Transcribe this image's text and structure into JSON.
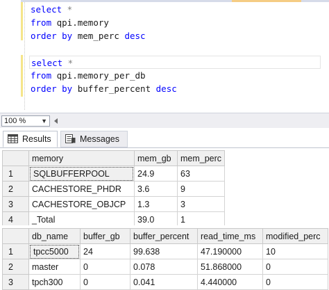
{
  "editor": {
    "lines": [
      {
        "kw1": "select",
        "rest": " *",
        "kind": "select"
      },
      {
        "kw1": "from",
        "rest": " qpi.memory",
        "kind": "from"
      },
      {
        "kw1": "order by",
        "rest": " mem_perc ",
        "kw2": "desc",
        "kind": "order"
      },
      {
        "kw1": "",
        "rest": "",
        "kind": "blank"
      },
      {
        "kw1": "select",
        "rest": " *",
        "kind": "select"
      },
      {
        "kw1": "from",
        "rest": " qpi.memory_per_db",
        "kind": "from"
      },
      {
        "kw1": "order by",
        "rest": " buffer_percent ",
        "kw2": "desc",
        "kind": "order"
      }
    ]
  },
  "zoom": {
    "value": "100 %"
  },
  "tabs": {
    "results": "Results",
    "messages": "Messages"
  },
  "grid1": {
    "columns": [
      "memory",
      "mem_gb",
      "mem_perc"
    ],
    "rows": [
      [
        "1",
        "SQLBUFFERPOOL",
        "24.9",
        "63"
      ],
      [
        "2",
        "CACHESTORE_PHDR",
        "3.6",
        "9"
      ],
      [
        "3",
        "CACHESTORE_OBJCP",
        "1.3",
        "3"
      ],
      [
        "4",
        "_Total",
        "39.0",
        "1"
      ]
    ]
  },
  "grid2": {
    "columns": [
      "db_name",
      "buffer_gb",
      "buffer_percent",
      "read_time_ms",
      "modified_perc"
    ],
    "rows": [
      [
        "1",
        "tpcc5000",
        "24",
        "99.638",
        "47.190000",
        "10"
      ],
      [
        "2",
        "master",
        "0",
        "0.078",
        "51.868000",
        "0"
      ],
      [
        "3",
        "tpch300",
        "0",
        "0.041",
        "4.440000",
        "0"
      ]
    ]
  }
}
